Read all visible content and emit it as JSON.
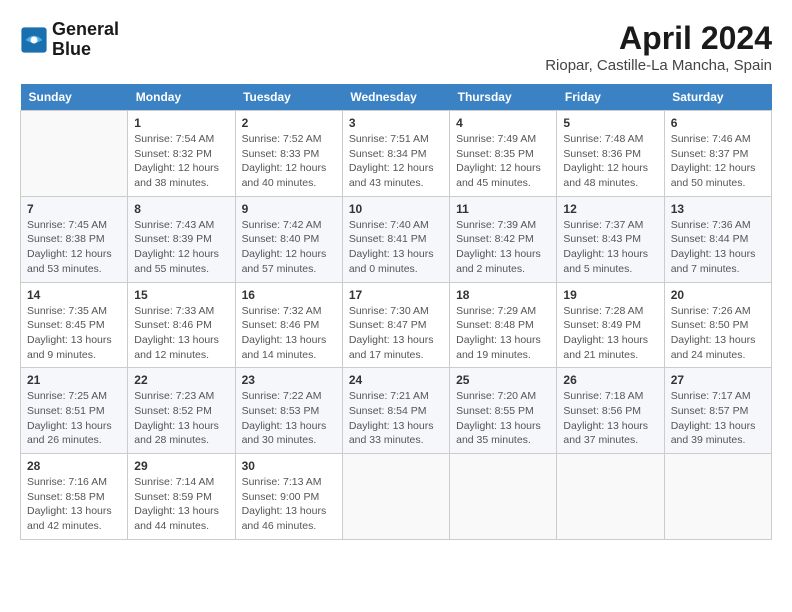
{
  "header": {
    "logo_line1": "General",
    "logo_line2": "Blue",
    "title": "April 2024",
    "subtitle": "Riopar, Castille-La Mancha, Spain"
  },
  "calendar": {
    "days_of_week": [
      "Sunday",
      "Monday",
      "Tuesday",
      "Wednesday",
      "Thursday",
      "Friday",
      "Saturday"
    ],
    "weeks": [
      [
        {
          "num": "",
          "info": ""
        },
        {
          "num": "1",
          "info": "Sunrise: 7:54 AM\nSunset: 8:32 PM\nDaylight: 12 hours\nand 38 minutes."
        },
        {
          "num": "2",
          "info": "Sunrise: 7:52 AM\nSunset: 8:33 PM\nDaylight: 12 hours\nand 40 minutes."
        },
        {
          "num": "3",
          "info": "Sunrise: 7:51 AM\nSunset: 8:34 PM\nDaylight: 12 hours\nand 43 minutes."
        },
        {
          "num": "4",
          "info": "Sunrise: 7:49 AM\nSunset: 8:35 PM\nDaylight: 12 hours\nand 45 minutes."
        },
        {
          "num": "5",
          "info": "Sunrise: 7:48 AM\nSunset: 8:36 PM\nDaylight: 12 hours\nand 48 minutes."
        },
        {
          "num": "6",
          "info": "Sunrise: 7:46 AM\nSunset: 8:37 PM\nDaylight: 12 hours\nand 50 minutes."
        }
      ],
      [
        {
          "num": "7",
          "info": "Sunrise: 7:45 AM\nSunset: 8:38 PM\nDaylight: 12 hours\nand 53 minutes."
        },
        {
          "num": "8",
          "info": "Sunrise: 7:43 AM\nSunset: 8:39 PM\nDaylight: 12 hours\nand 55 minutes."
        },
        {
          "num": "9",
          "info": "Sunrise: 7:42 AM\nSunset: 8:40 PM\nDaylight: 12 hours\nand 57 minutes."
        },
        {
          "num": "10",
          "info": "Sunrise: 7:40 AM\nSunset: 8:41 PM\nDaylight: 13 hours\nand 0 minutes."
        },
        {
          "num": "11",
          "info": "Sunrise: 7:39 AM\nSunset: 8:42 PM\nDaylight: 13 hours\nand 2 minutes."
        },
        {
          "num": "12",
          "info": "Sunrise: 7:37 AM\nSunset: 8:43 PM\nDaylight: 13 hours\nand 5 minutes."
        },
        {
          "num": "13",
          "info": "Sunrise: 7:36 AM\nSunset: 8:44 PM\nDaylight: 13 hours\nand 7 minutes."
        }
      ],
      [
        {
          "num": "14",
          "info": "Sunrise: 7:35 AM\nSunset: 8:45 PM\nDaylight: 13 hours\nand 9 minutes."
        },
        {
          "num": "15",
          "info": "Sunrise: 7:33 AM\nSunset: 8:46 PM\nDaylight: 13 hours\nand 12 minutes."
        },
        {
          "num": "16",
          "info": "Sunrise: 7:32 AM\nSunset: 8:46 PM\nDaylight: 13 hours\nand 14 minutes."
        },
        {
          "num": "17",
          "info": "Sunrise: 7:30 AM\nSunset: 8:47 PM\nDaylight: 13 hours\nand 17 minutes."
        },
        {
          "num": "18",
          "info": "Sunrise: 7:29 AM\nSunset: 8:48 PM\nDaylight: 13 hours\nand 19 minutes."
        },
        {
          "num": "19",
          "info": "Sunrise: 7:28 AM\nSunset: 8:49 PM\nDaylight: 13 hours\nand 21 minutes."
        },
        {
          "num": "20",
          "info": "Sunrise: 7:26 AM\nSunset: 8:50 PM\nDaylight: 13 hours\nand 24 minutes."
        }
      ],
      [
        {
          "num": "21",
          "info": "Sunrise: 7:25 AM\nSunset: 8:51 PM\nDaylight: 13 hours\nand 26 minutes."
        },
        {
          "num": "22",
          "info": "Sunrise: 7:23 AM\nSunset: 8:52 PM\nDaylight: 13 hours\nand 28 minutes."
        },
        {
          "num": "23",
          "info": "Sunrise: 7:22 AM\nSunset: 8:53 PM\nDaylight: 13 hours\nand 30 minutes."
        },
        {
          "num": "24",
          "info": "Sunrise: 7:21 AM\nSunset: 8:54 PM\nDaylight: 13 hours\nand 33 minutes."
        },
        {
          "num": "25",
          "info": "Sunrise: 7:20 AM\nSunset: 8:55 PM\nDaylight: 13 hours\nand 35 minutes."
        },
        {
          "num": "26",
          "info": "Sunrise: 7:18 AM\nSunset: 8:56 PM\nDaylight: 13 hours\nand 37 minutes."
        },
        {
          "num": "27",
          "info": "Sunrise: 7:17 AM\nSunset: 8:57 PM\nDaylight: 13 hours\nand 39 minutes."
        }
      ],
      [
        {
          "num": "28",
          "info": "Sunrise: 7:16 AM\nSunset: 8:58 PM\nDaylight: 13 hours\nand 42 minutes."
        },
        {
          "num": "29",
          "info": "Sunrise: 7:14 AM\nSunset: 8:59 PM\nDaylight: 13 hours\nand 44 minutes."
        },
        {
          "num": "30",
          "info": "Sunrise: 7:13 AM\nSunset: 9:00 PM\nDaylight: 13 hours\nand 46 minutes."
        },
        {
          "num": "",
          "info": ""
        },
        {
          "num": "",
          "info": ""
        },
        {
          "num": "",
          "info": ""
        },
        {
          "num": "",
          "info": ""
        }
      ]
    ]
  }
}
